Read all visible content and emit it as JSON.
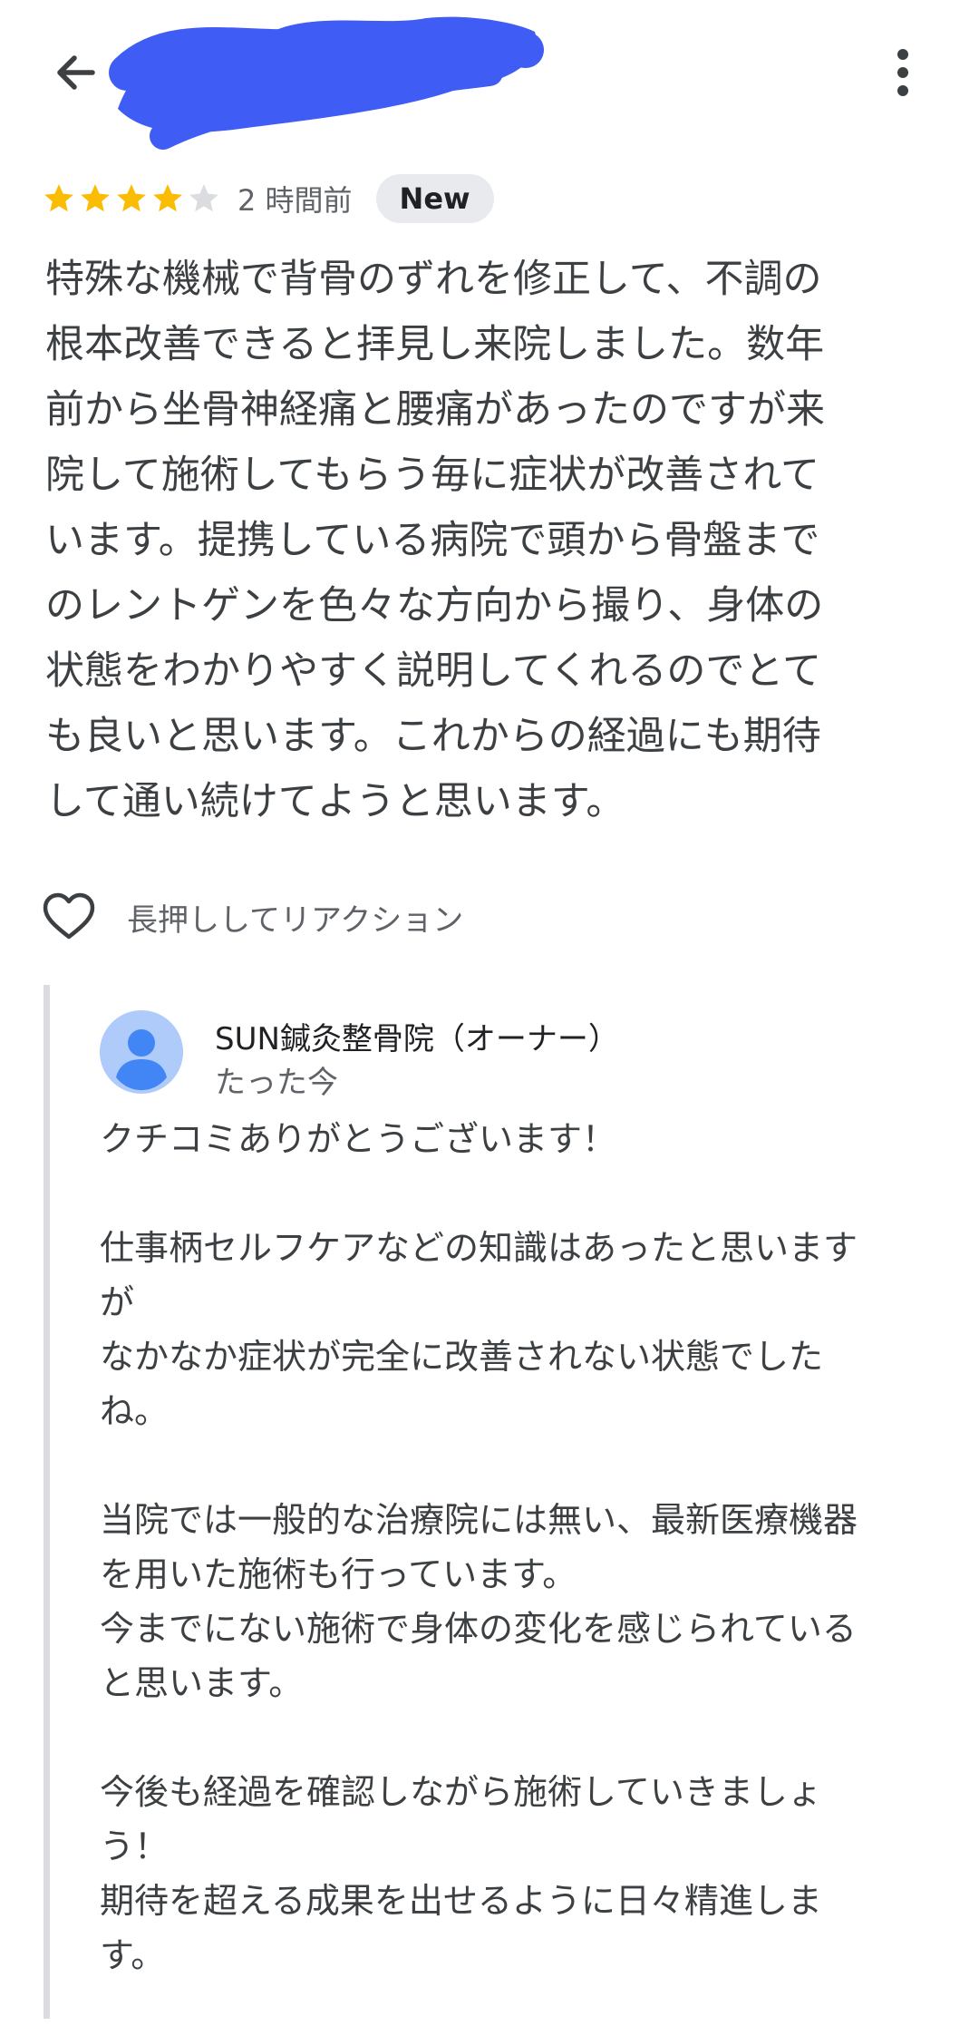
{
  "review": {
    "rating": 4,
    "max_rating": 5,
    "time_ago": "2 時間前",
    "badge": "New",
    "text": "特殊な機械で背骨のずれを修正して、不調の\n根本改善できると拝見し来院しました。数年\n前から坐骨神経痛と腰痛があったのですが来\n院して施術してもらう毎に症状が改善されて\nいます。提携している病院で頭から骨盤まで\nのレントゲンを色々な方向から撮り、身体の\n状態をわかりやすく説明してくれるのでとて\nも良いと思います。これからの経過にも期待\nして通い続けてようと思います。"
  },
  "reaction": {
    "label": "長押ししてリアクション"
  },
  "reply": {
    "owner_name": "SUN鍼灸整骨院（オーナー）",
    "time": "たった今",
    "text": "クチコミありがとうございます！\n\n仕事柄セルフケアなどの知識はあったと思います\nが\nなかなか症状が完全に改善されない状態でした\nね。\n\n当院では一般的な治療院には無い、最新医療機器\nを用いた施術も行っています。\n今までにない施術で身体の変化を感じられている\nと思います。\n\n今後も経過を確認しながら施術していきましょ\nう！\n期待を超える成果を出せるように日々精進しま\nす。"
  },
  "colors": {
    "star_filled": "#fbbc04",
    "star_empty": "#dadce0",
    "redaction": "#3f5cf5",
    "avatar_bg": "#aecbfa",
    "avatar_fg": "#4285f4"
  },
  "icons": {
    "back": "arrow-back-icon",
    "more": "more-vert-icon",
    "heart": "heart-outline-icon",
    "avatar": "person-avatar-icon"
  }
}
